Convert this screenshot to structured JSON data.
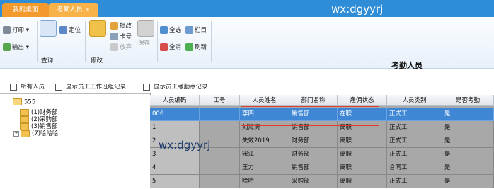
{
  "tabs": [
    {
      "label": "我的桌面"
    },
    {
      "label": "考勤人员",
      "close": "×"
    }
  ],
  "watermark": "wx:dgyyrj",
  "toolbar": {
    "print": "打印",
    "export": "输出",
    "query": "查询",
    "locate": "定位",
    "modify": "修改",
    "batch_modify": "批改",
    "card_no": "卡号",
    "discard": "放弃",
    "save": "保存",
    "select_all": "全选",
    "columns": "栏目",
    "clear_all": "全消",
    "refresh": "刷新"
  },
  "page_title": "考勤人员",
  "checks": {
    "all_staff": "所有人员",
    "show_shift": "显示员工工作班组记录",
    "show_points": "显示员工考勤点记录"
  },
  "tree": {
    "root": "555",
    "children": [
      "(1)财务部",
      "(2)采购部",
      "(3)销售部",
      "(7)哈哈哈"
    ]
  },
  "grid": {
    "columns": [
      "人员编码",
      "工号",
      "人员姓名",
      "部门名称",
      "雇佣状态",
      "人员类别",
      "是否考勤"
    ],
    "rows": [
      [
        "006",
        "",
        "李四",
        "销售部",
        "在职",
        "正式工",
        "是"
      ],
      [
        "1",
        "",
        "刘海涛",
        "销售部",
        "离职",
        "正式工",
        "是"
      ],
      [
        "2",
        "",
        "失效2019",
        "财务部",
        "离职",
        "正式工",
        "是"
      ],
      [
        "3",
        "",
        "宋江",
        "财务部",
        "离职",
        "正式工",
        "是"
      ],
      [
        "4",
        "",
        "王力",
        "销售部",
        "离职",
        "合同工",
        "是"
      ],
      [
        "5",
        "",
        "哈哈",
        "采购部",
        "离职",
        "正式工",
        "是"
      ]
    ]
  }
}
